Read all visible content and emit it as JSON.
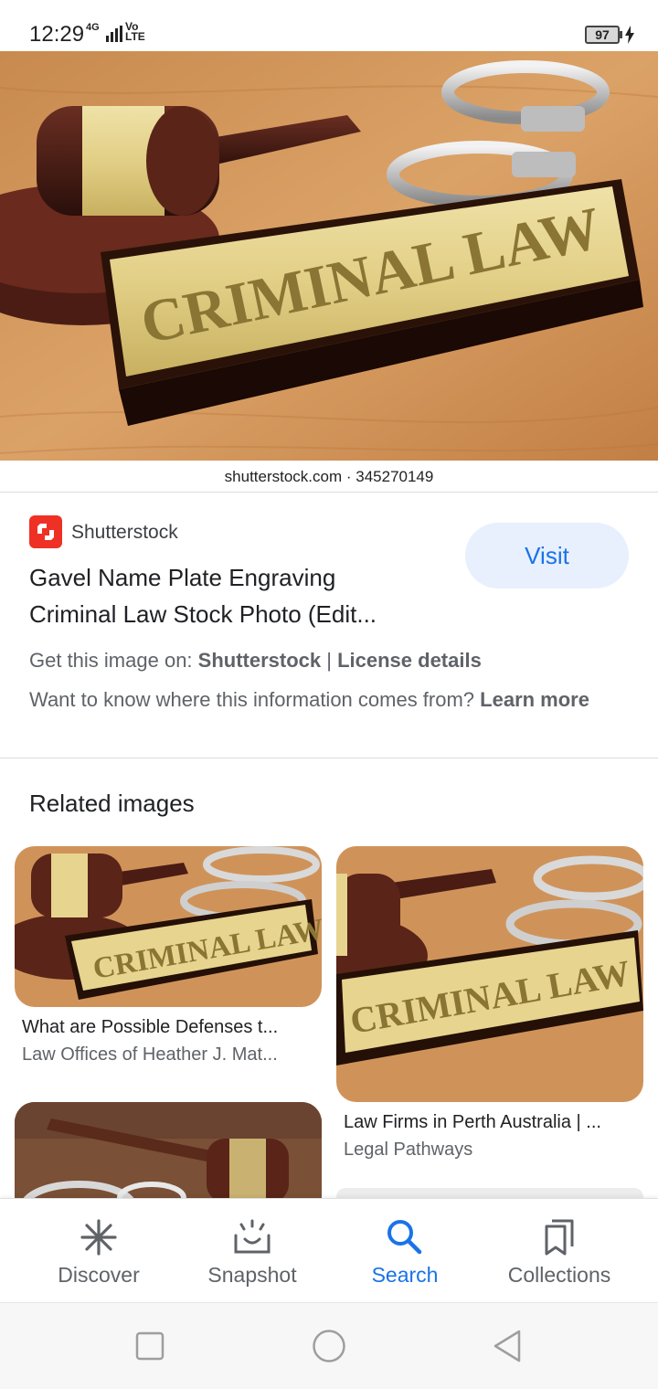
{
  "status_bar": {
    "time": "12:29",
    "network": "4G",
    "volte": "Vo LTE",
    "battery": "97"
  },
  "hero": {
    "plate_text": "CRIMINAL LAW",
    "source_line": "shutterstock.com · 345270149"
  },
  "result": {
    "site_name": "Shutterstock",
    "title_line1": "Gavel Name Plate Engraving",
    "title_line2": "Criminal Law Stock Photo (Edit...",
    "visit_label": "Visit",
    "get_prefix": "Get this image on: ",
    "get_site": "Shutterstock",
    "get_sep": " | ",
    "license_label": "License details",
    "want_text": "Want to know where this information comes from? ",
    "learn_more": "Learn more"
  },
  "related": {
    "heading": "Related images",
    "items": [
      {
        "plate": "CRIMINAL LAW",
        "title": "What are Possible Defenses t...",
        "source": "Law Offices of Heather J. Mat..."
      },
      {
        "plate": "CRIMINAL LAW",
        "title": "Law Firms in Perth Australia | ...",
        "source": "Legal Pathways"
      }
    ]
  },
  "bottom_nav": {
    "items": [
      {
        "label": "Discover",
        "icon": "asterisk-icon"
      },
      {
        "label": "Snapshot",
        "icon": "snapshot-icon"
      },
      {
        "label": "Search",
        "icon": "search-icon"
      },
      {
        "label": "Collections",
        "icon": "collections-icon"
      }
    ],
    "active": "Search",
    "active_color": "#1a73e8"
  },
  "colors": {
    "accent": "#1a73e8",
    "visit_bg": "#e8f0fe",
    "shutterstock_red": "#ee3124"
  }
}
